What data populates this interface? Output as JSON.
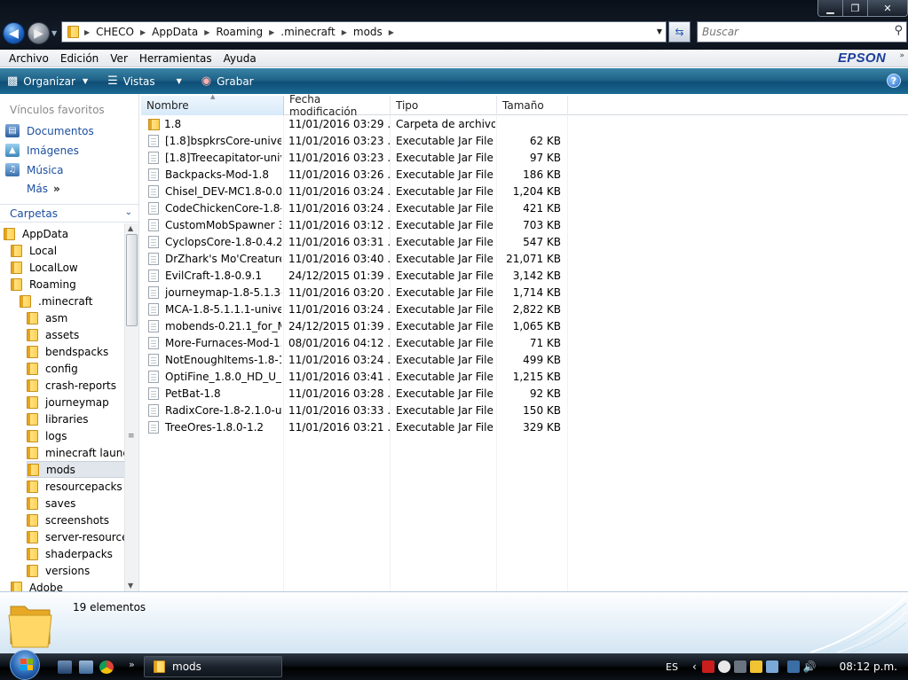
{
  "window": {
    "buttons": {
      "minimize": "▁",
      "maximize": "❐",
      "close": "✕"
    }
  },
  "address": {
    "path": [
      "CHECO",
      "AppData",
      "Roaming",
      ".minecraft",
      "mods"
    ]
  },
  "search": {
    "placeholder": "Buscar"
  },
  "menu": [
    "Archivo",
    "Edición",
    "Ver",
    "Herramientas",
    "Ayuda"
  ],
  "brand": "EPSON",
  "commands": {
    "organize": "Organizar",
    "views": "Vistas",
    "burn": "Grabar"
  },
  "nav": {
    "favorites_header": "Vínculos favoritos",
    "favorites": [
      "Documentos",
      "Imágenes",
      "Música",
      "Más"
    ],
    "folders_header": "Carpetas",
    "tree": [
      {
        "label": "AppData",
        "level": 0
      },
      {
        "label": "Local",
        "level": 1
      },
      {
        "label": "LocalLow",
        "level": 1
      },
      {
        "label": "Roaming",
        "level": 1
      },
      {
        "label": ".minecraft",
        "level": 2
      },
      {
        "label": "asm",
        "level": 3
      },
      {
        "label": "assets",
        "level": 3
      },
      {
        "label": "bendspacks",
        "level": 3
      },
      {
        "label": "config",
        "level": 3
      },
      {
        "label": "crash-reports",
        "level": 3
      },
      {
        "label": "journeymap",
        "level": 3
      },
      {
        "label": "libraries",
        "level": 3
      },
      {
        "label": "logs",
        "level": 3
      },
      {
        "label": "minecraft launch",
        "level": 3
      },
      {
        "label": "mods",
        "level": 3,
        "selected": true
      },
      {
        "label": "resourcepacks",
        "level": 3
      },
      {
        "label": "saves",
        "level": 3
      },
      {
        "label": "screenshots",
        "level": 3
      },
      {
        "label": "server-resource-",
        "level": 3
      },
      {
        "label": "shaderpacks",
        "level": 3
      },
      {
        "label": "versions",
        "level": 3
      },
      {
        "label": "Adobe",
        "level": 1
      }
    ]
  },
  "columns": [
    "Nombre",
    "Fecha modificación",
    "Tipo",
    "Tamaño"
  ],
  "files": [
    {
      "name": "1.8",
      "date": "11/01/2016 03:29 ...",
      "type": "Carpeta de archivos",
      "size": "",
      "folder": true
    },
    {
      "name": "[1.8]bspkrsCore-univer...",
      "date": "11/01/2016 03:23 ...",
      "type": "Executable Jar File",
      "size": "62 KB"
    },
    {
      "name": "[1.8]Treecapitator-univ...",
      "date": "11/01/2016 03:23 ...",
      "type": "Executable Jar File",
      "size": "97 KB"
    },
    {
      "name": "Backpacks-Mod-1.8",
      "date": "11/01/2016 03:26 ...",
      "type": "Executable Jar File",
      "size": "186 KB"
    },
    {
      "name": "Chisel_DEV-MC1.8-0.0...",
      "date": "11/01/2016 03:24 ...",
      "type": "Executable Jar File",
      "size": "1,204 KB"
    },
    {
      "name": "CodeChickenCore-1.8-...",
      "date": "11/01/2016 03:24 ...",
      "type": "Executable Jar File",
      "size": "421 KB"
    },
    {
      "name": "CustomMobSpawner 3....",
      "date": "11/01/2016 03:12 ...",
      "type": "Executable Jar File",
      "size": "703 KB"
    },
    {
      "name": "CyclopsCore-1.8-0.4.2",
      "date": "11/01/2016 03:31 ...",
      "type": "Executable Jar File",
      "size": "547 KB"
    },
    {
      "name": "DrZhark's Mo'Creature...",
      "date": "11/01/2016 03:40 ...",
      "type": "Executable Jar File",
      "size": "21,071 KB"
    },
    {
      "name": "EvilCraft-1.8-0.9.1",
      "date": "24/12/2015 01:39 ...",
      "type": "Executable Jar File",
      "size": "3,142 KB"
    },
    {
      "name": "journeymap-1.8-5.1.3-...",
      "date": "11/01/2016 03:20 ...",
      "type": "Executable Jar File",
      "size": "1,714 KB"
    },
    {
      "name": "MCA-1.8-5.1.1.1-unive...",
      "date": "11/01/2016 03:24 ...",
      "type": "Executable Jar File",
      "size": "2,822 KB"
    },
    {
      "name": "mobends-0.21.1_for_M...",
      "date": "24/12/2015 01:39 ...",
      "type": "Executable Jar File",
      "size": "1,065 KB"
    },
    {
      "name": "More-Furnaces-Mod-1.8",
      "date": "08/01/2016 04:12 ...",
      "type": "Executable Jar File",
      "size": "71 KB"
    },
    {
      "name": "NotEnoughItems-1.8-1....",
      "date": "11/01/2016 03:24 ...",
      "type": "Executable Jar File",
      "size": "499 KB"
    },
    {
      "name": "OptiFine_1.8.0_HD_U_G9",
      "date": "11/01/2016 03:41 ...",
      "type": "Executable Jar File",
      "size": "1,215 KB"
    },
    {
      "name": "PetBat-1.8",
      "date": "11/01/2016 03:28 ...",
      "type": "Executable Jar File",
      "size": "92 KB"
    },
    {
      "name": "RadixCore-1.8-2.1.0-un...",
      "date": "11/01/2016 03:33 ...",
      "type": "Executable Jar File",
      "size": "150 KB"
    },
    {
      "name": "TreeOres-1.8.0-1.2",
      "date": "11/01/2016 03:21 ...",
      "type": "Executable Jar File",
      "size": "329 KB"
    }
  ],
  "status": {
    "count": "19 elementos"
  },
  "taskbar": {
    "task": "mods",
    "lang": "ES",
    "clock": "08:12 p.m."
  },
  "colors": {
    "accent": "#1f6288",
    "link": "#1a4e9e",
    "brand": "#1a3e9a"
  }
}
